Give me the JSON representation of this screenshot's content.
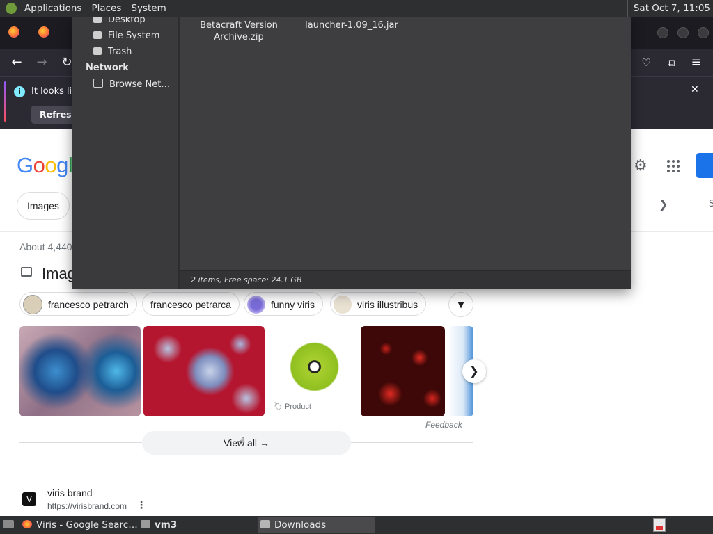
{
  "top_panel": {
    "menus": [
      "Applications",
      "Places",
      "System"
    ],
    "clock": "Sat Oct  7, 11:05"
  },
  "firefox": {
    "notice_message": "It looks lik",
    "refresh_label": "Refresh I"
  },
  "google": {
    "logo_letters": [
      "G",
      "o",
      "o",
      "g",
      "l"
    ],
    "filter_chip": "Images",
    "result_stats": "About 4,440",
    "images_heading": "Imag",
    "suggestions": [
      "francesco petrarch",
      "francesco petrarca",
      "funny viris",
      "viris illustribus"
    ],
    "image_tag": "Product",
    "feedback": "Feedback",
    "view_all": "View all",
    "result": {
      "site_name": "viris brand",
      "site_url": "https://virisbrand.com",
      "favicon": "V"
    },
    "colors": {
      "blue": "#4285f4",
      "red": "#ea4335",
      "yellow": "#fbbc05",
      "green": "#34a853"
    }
  },
  "file_manager": {
    "sidebar_items": [
      "Desktop",
      "File System",
      "Trash"
    ],
    "network_heading": "Network",
    "network_items": [
      "Browse Net…"
    ],
    "files": [
      {
        "name": "Betacraft Version Archive.zip",
        "line1": "Betacraft Version",
        "line2": "Archive.zip"
      },
      {
        "name": "launcher-1.09_16.jar",
        "line1": "launcher-1.09_16.jar",
        "line2": ""
      }
    ],
    "status": "2 items, Free space: 24.1 GB"
  },
  "taskbar": {
    "tasks": [
      "Viris - Google Searc…",
      "vm3",
      "Downloads"
    ],
    "active_task": "Downloads"
  }
}
